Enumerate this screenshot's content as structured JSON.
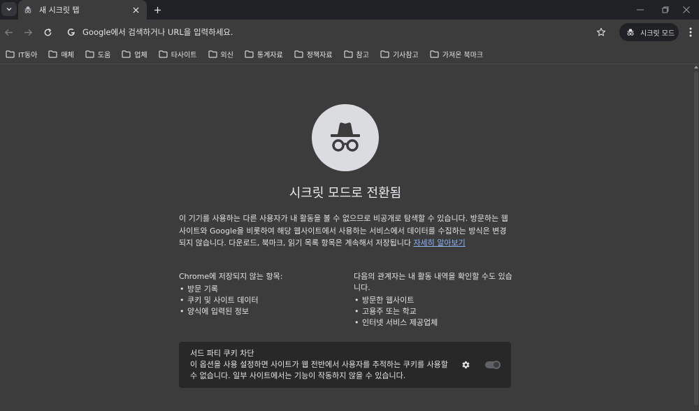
{
  "tab": {
    "title": "새 시크릿 탭"
  },
  "omnibox": {
    "placeholder": "Google에서 검색하거나 URL을 입력하세요."
  },
  "profile": {
    "label": "시크릿 모드"
  },
  "bookmarks": [
    {
      "label": "IT동아"
    },
    {
      "label": "매체"
    },
    {
      "label": "도움"
    },
    {
      "label": "업체"
    },
    {
      "label": "타사이트"
    },
    {
      "label": "외신"
    },
    {
      "label": "통계자료"
    },
    {
      "label": "정책자료"
    },
    {
      "label": "참고"
    },
    {
      "label": "기사참고"
    },
    {
      "label": "가져온 북마크"
    }
  ],
  "main": {
    "heading": "시크릿 모드로 전환됨",
    "description": "이 기기를 사용하는 다른 사용자가 내 활동을 볼 수 없으므로 비공개로 탐색할 수 있습니다. 방문하는 웹사이트와 Google을 비롯하여 해당 웹사이트에서 사용하는 서비스에서 데이터를 수집하는 방식은 변경되지 않습니다. 다운로드, 북마크, 읽기 목록 항목은 계속해서 저장됩니다 ",
    "learn_more": "자세히 알아보기",
    "not_saved": {
      "title": "Chrome에 저장되지 않는 항목:",
      "items": [
        "방문 기록",
        "쿠키 및 사이트 데이터",
        "양식에 입력된 정보"
      ]
    },
    "visible_to": {
      "title": "다음의 관계자는 내 활동 내역을 확인할 수도 있습니다.",
      "items": [
        "방문한 웹사이트",
        "고용주 또는 학교",
        "인터넷 서비스 제공업체"
      ]
    },
    "cookie_card": {
      "title": "서드 파티 쿠키 차단",
      "description": "이 옵션을 사용 설정하면 사이트가 웹 전반에서 사용자를 추적하는 쿠키를 사용할 수 없습니다. 일부 사이트에서는 기능이 작동하지 않을 수 있습니다."
    }
  }
}
